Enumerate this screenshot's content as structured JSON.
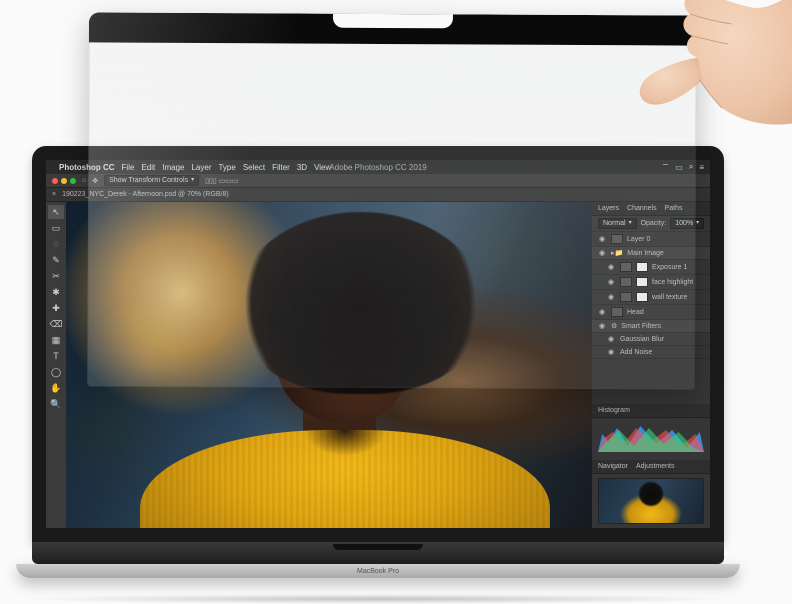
{
  "product": {
    "laptop_label": "MacBook Pro"
  },
  "mac_menu": {
    "app": "Photoshop CC",
    "items": [
      "File",
      "Edit",
      "Image",
      "Layer",
      "Type",
      "Select",
      "Filter",
      "3D",
      "View"
    ],
    "center": "Adobe Photoshop CC 2019"
  },
  "options_bar": {
    "label": "Show Transform Controls"
  },
  "tab": {
    "label": "190223_NYC_Derek - Afternoon.psd @ 70% (RGB/8)"
  },
  "tools": [
    "↖",
    "▭",
    "◌",
    "✎",
    "✂",
    "✱",
    "✚",
    "⌫",
    "▦",
    "T",
    "◯",
    "✋",
    "🔍"
  ],
  "panels": {
    "tabs": [
      "Layers",
      "Channels",
      "Paths"
    ],
    "blend_mode": "Normal",
    "opacity_label": "Opacity:",
    "opacity_value": "100%",
    "layers": [
      {
        "name": "Layer 0"
      },
      {
        "name": "Main Image",
        "group": true
      },
      {
        "name": "Exposure 1",
        "indent": true
      },
      {
        "name": "face highlight",
        "indent": true
      },
      {
        "name": "wall texture",
        "indent": true
      },
      {
        "name": "Head"
      },
      {
        "name": "Smart Filters",
        "group": true
      },
      {
        "name": "Gaussian Blur",
        "indent": true
      },
      {
        "name": "Add Noise",
        "indent": true
      }
    ],
    "histogram_label": "Histogram",
    "navigator_label": "Navigator",
    "adjustments_label": "Adjustments"
  }
}
